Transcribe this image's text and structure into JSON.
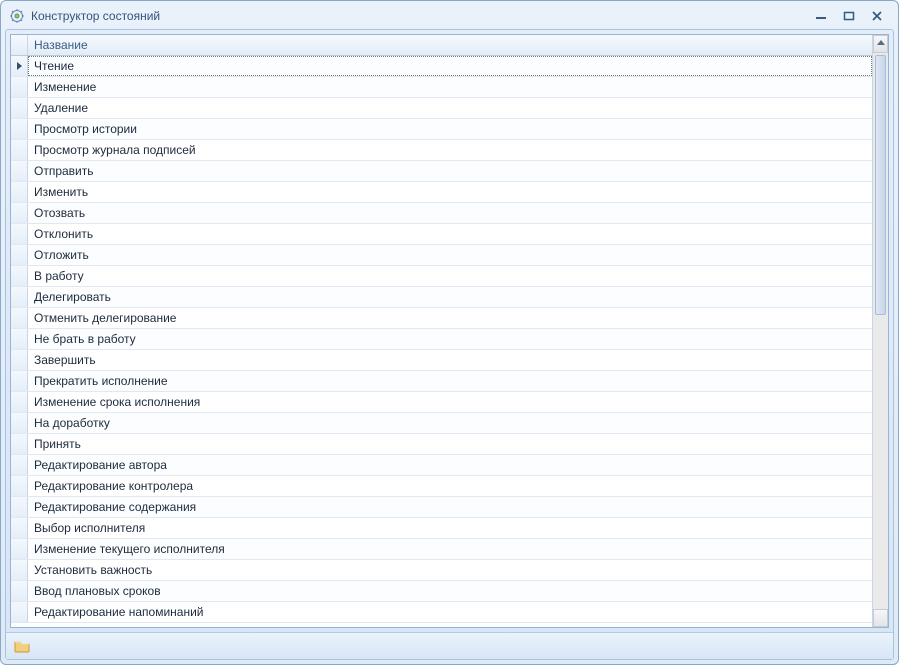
{
  "window": {
    "title": "Конструктор состояний"
  },
  "grid": {
    "header": "Название",
    "selected_index": 0,
    "rows": [
      "Чтение",
      "Изменение",
      "Удаление",
      "Просмотр истории",
      "Просмотр журнала подписей",
      "Отправить",
      "Изменить",
      "Отозвать",
      "Отклонить",
      "Отложить",
      "В работу",
      "Делегировать",
      "Отменить делегирование",
      "Не брать в работу",
      "Завершить",
      "Прекратить исполнение",
      "Изменение срока исполнения",
      "На доработку",
      "Принять",
      "Редактирование автора",
      "Редактирование контролера",
      "Редактирование содержания",
      "Выбор исполнителя",
      "Изменение текущего исполнителя",
      "Установить важность",
      "Ввод плановых сроков",
      "Редактирование напоминаний"
    ]
  }
}
